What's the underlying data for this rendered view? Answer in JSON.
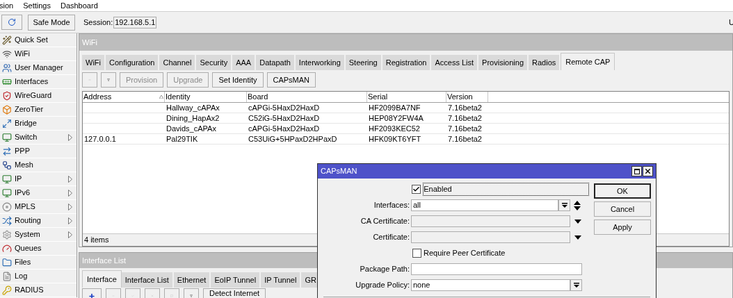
{
  "menu": [
    "sion",
    "Settings",
    "Dashboard"
  ],
  "toolbar": {
    "safe_mode": "Safe Mode",
    "session_label": "Session:",
    "session_value": "192.168.5.1",
    "corner_text": "U"
  },
  "sidebar": [
    {
      "label": "Quick Set",
      "submenu": false
    },
    {
      "label": "WiFi",
      "submenu": false
    },
    {
      "label": "User Manager",
      "submenu": false
    },
    {
      "label": "Interfaces",
      "submenu": false
    },
    {
      "label": "WireGuard",
      "submenu": false
    },
    {
      "label": "ZeroTier",
      "submenu": false
    },
    {
      "label": "Bridge",
      "submenu": false
    },
    {
      "label": "Switch",
      "submenu": true
    },
    {
      "label": "PPP",
      "submenu": false
    },
    {
      "label": "Mesh",
      "submenu": false
    },
    {
      "label": "IP",
      "submenu": true
    },
    {
      "label": "IPv6",
      "submenu": true
    },
    {
      "label": "MPLS",
      "submenu": true
    },
    {
      "label": "Routing",
      "submenu": true
    },
    {
      "label": "System",
      "submenu": true
    },
    {
      "label": "Queues",
      "submenu": false
    },
    {
      "label": "Files",
      "submenu": false
    },
    {
      "label": "Log",
      "submenu": false
    },
    {
      "label": "RADIUS",
      "submenu": false
    }
  ],
  "wifi_window": {
    "title": "WiFi",
    "tabs": [
      {
        "label": "WiFi",
        "selected": false
      },
      {
        "label": "Configuration",
        "selected": false
      },
      {
        "label": "Channel",
        "selected": false
      },
      {
        "label": "Security",
        "selected": false
      },
      {
        "label": "AAA",
        "selected": false
      },
      {
        "label": "Datapath",
        "selected": false
      },
      {
        "label": "Interworking",
        "selected": false
      },
      {
        "label": "Steering",
        "selected": false
      },
      {
        "label": "Registration",
        "selected": false
      },
      {
        "label": "Access List",
        "selected": false
      },
      {
        "label": "Provisioning",
        "selected": false
      },
      {
        "label": "Radios",
        "selected": false
      },
      {
        "label": "Remote CAP",
        "selected": true
      }
    ],
    "buttons": [
      {
        "label": "Provision",
        "disabled": true
      },
      {
        "label": "Upgrade",
        "disabled": true
      },
      {
        "label": "Set Identity",
        "disabled": false
      },
      {
        "label": "CAPsMAN",
        "disabled": false
      }
    ],
    "table": {
      "columns": [
        "Address",
        "Identity",
        "Board",
        "Serial",
        "Version"
      ],
      "rows": [
        [
          "",
          "Hallway_cAPAx",
          "cAPGi-5HaxD2HaxD",
          "HF2099BA7NF",
          "7.16beta2"
        ],
        [
          "",
          "Dining_HapAx2",
          "C52iG-5HaxD2HaxD",
          "HEP08Y2FW4A",
          "7.16beta2"
        ],
        [
          "",
          "Davids_cAPAx",
          "cAPGi-5HaxD2HaxD",
          "HF2093KEC52",
          "7.16beta2"
        ],
        [
          "127.0.0.1",
          "Pal29TIK",
          "C53UiG+5HPaxD2HPaxD",
          "HFK09KT6YFT",
          "7.16beta2"
        ]
      ]
    },
    "status": "4 items"
  },
  "interface_window": {
    "title": "Interface List",
    "tabs": [
      {
        "label": "Interface",
        "selected": true
      },
      {
        "label": "Interface List",
        "selected": false
      },
      {
        "label": "Ethernet",
        "selected": false
      },
      {
        "label": "EoIP Tunnel",
        "selected": false
      },
      {
        "label": "IP Tunnel",
        "selected": false
      },
      {
        "label": "GR",
        "selected": false
      }
    ],
    "detect_button": "Detect Internet"
  },
  "dialog": {
    "title": "CAPsMAN",
    "rows": [
      {
        "kind": "checkbox",
        "label": "Enabled",
        "checked": true,
        "focused": true
      },
      {
        "kind": "multi",
        "label": "Interfaces:",
        "value": "all"
      },
      {
        "kind": "select",
        "label": "CA Certificate:"
      },
      {
        "kind": "select",
        "label": "Certificate:"
      },
      {
        "kind": "checkbox",
        "label": "Require Peer Certificate",
        "checked": false,
        "focused": false
      },
      {
        "kind": "text",
        "label": "Package Path:"
      },
      {
        "kind": "dropdown",
        "label": "Upgrade Policy:",
        "value": "none"
      }
    ],
    "buttons": [
      {
        "label": "OK",
        "default": true
      },
      {
        "label": "Cancel",
        "default": false
      },
      {
        "label": "Apply",
        "default": false
      }
    ]
  }
}
